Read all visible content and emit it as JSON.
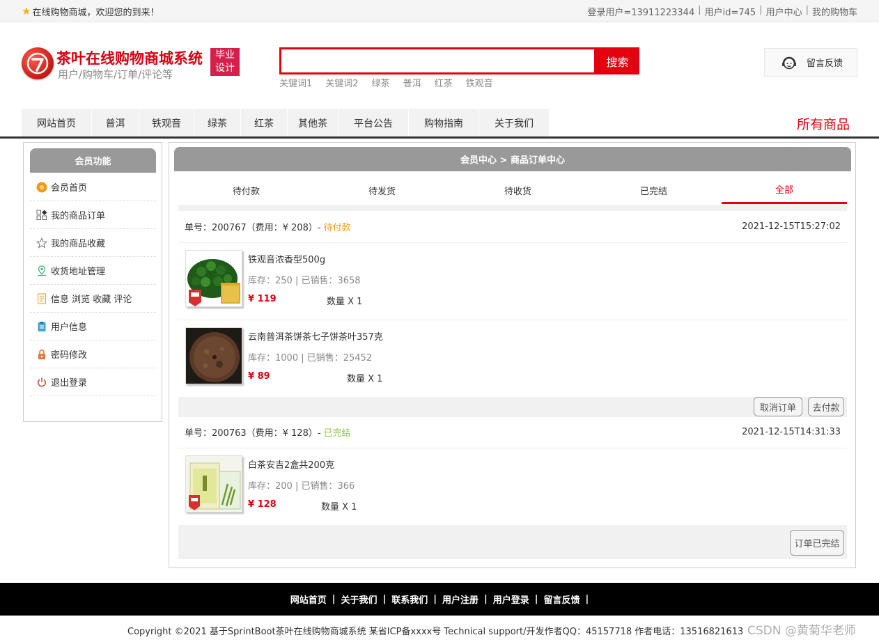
{
  "topbar": {
    "welcome": "在线购物商城，欢迎您的到来！",
    "login_user": "登录用户=13911223344",
    "user_id": "用户id=745",
    "user_center": "用户中心",
    "cart": "我的购物车",
    "sep": "|"
  },
  "header": {
    "title": "茶叶在线购物商城系统",
    "subtitle": "用户/购物车/订单/评论等",
    "badge_line1": "毕业",
    "badge_line2": "设计",
    "search_placeholder": "",
    "search_button": "搜索",
    "hot_words": [
      "关键词1",
      "关键词2",
      "绿茶",
      "普洱",
      "红茶",
      "铁观音"
    ],
    "feedback": "留言反馈"
  },
  "nav": {
    "items": [
      "网站首页",
      "普洱",
      "铁观音",
      "绿茶",
      "红茶",
      "其他茶",
      "平台公告",
      "购物指南",
      "关于我们"
    ],
    "all_goods": "所有商品"
  },
  "sidebar": {
    "title": "会员功能",
    "items": [
      "会员首页",
      "我的商品订单",
      "我的商品收藏",
      "收货地址管理",
      "信息 浏览 收藏 评论",
      "用户信息",
      "密码修改",
      "退出登录"
    ],
    "icons": [
      "home-orange-icon",
      "grid-icon",
      "star-outline-icon",
      "location-pin-icon",
      "document-icon",
      "clipboard-icon",
      "lock-icon",
      "power-icon"
    ]
  },
  "main": {
    "breadcrumb": "会员中心 > 商品订单中心",
    "tabs": [
      "待付款",
      "待发货",
      "待收货",
      "已完结",
      "全部"
    ],
    "active_tab": "全部"
  },
  "orders": [
    {
      "number_label": "单号：200767（费用：¥ 208）- ",
      "status": "待付款",
      "time": "2021-12-15T15:27:02",
      "products": [
        {
          "name": "铁观音浓香型500g",
          "stock": "库存：250 | 已销售：3658",
          "price": "¥ 119",
          "qty": "数量 X 1"
        },
        {
          "name": "云南普洱茶饼茶七子饼茶叶357克",
          "stock": "库存：1000 | 已销售：25452",
          "price": "¥ 89",
          "qty": "数量 X 1"
        }
      ],
      "buttons": [
        "取消订单",
        "去付款"
      ]
    },
    {
      "number_label": "单号：200763（费用：¥ 128）- ",
      "status": "已完结",
      "time": "2021-12-15T14:31:33",
      "products": [
        {
          "name": "白茶安吉2盒共200克",
          "stock": "库存：200 | 已销售：366",
          "price": "¥ 128",
          "qty": "数量 X 1"
        }
      ],
      "buttons": [
        "订单已完结"
      ]
    }
  ],
  "footer": {
    "links": [
      "网站首页",
      "关于我们",
      "联系我们",
      "用户注册",
      "用户登录",
      "留言反馈"
    ],
    "sep": "|",
    "copyright": "Copyright ©2021 基于SprintBoot茶叶在线购物商城系统    某省ICP备xxxx号    Technical support/开发作者QQ：45157718    作者电话：13516821613",
    "watermark": "CSDN @黄菊华老师"
  },
  "colors": {
    "accent_red": "#e4000f",
    "pending_orange": "#f39a1a",
    "done_green": "#8bc34a",
    "header_gray": "#999999"
  }
}
